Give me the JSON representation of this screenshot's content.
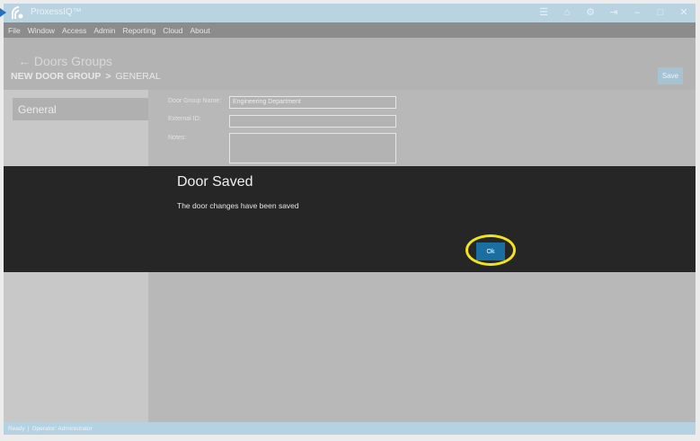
{
  "app": {
    "title": "ProxessIQ™"
  },
  "titlebar": {
    "icons": [
      "menu-icon",
      "home-icon",
      "gear-icon",
      "logout-icon",
      "minimize-icon",
      "maximize-icon",
      "close-icon"
    ]
  },
  "menu": [
    {
      "label": "File"
    },
    {
      "label": "Window"
    },
    {
      "label": "Access"
    },
    {
      "label": "Admin"
    },
    {
      "label": "Reporting"
    },
    {
      "label": "Cloud"
    },
    {
      "label": "About"
    }
  ],
  "header": {
    "back_label": "← Doors Groups",
    "crumb_main": "NEW DOOR GROUP",
    "crumb_sep": ">",
    "crumb_sub": "GENERAL",
    "save_label": "Save"
  },
  "sidebar": {
    "items": [
      {
        "label": "General"
      }
    ]
  },
  "form": {
    "name_label": "Door Group Name:",
    "name_value": "Engineering Department",
    "external_label": "External ID:",
    "external_value": "",
    "notes_label": "Notes:",
    "notes_value": ""
  },
  "dialog": {
    "title": "Door Saved",
    "message": "The door changes have been saved",
    "ok_label": "Ok",
    "highlight_color": "#f2e41c"
  },
  "status": {
    "state": "Ready",
    "operator": "Operator: Administrator"
  },
  "colors": {
    "titlebar": "#b9d3e1",
    "dialog_bg": "#262626",
    "ok_button": "#1b6fa0"
  }
}
